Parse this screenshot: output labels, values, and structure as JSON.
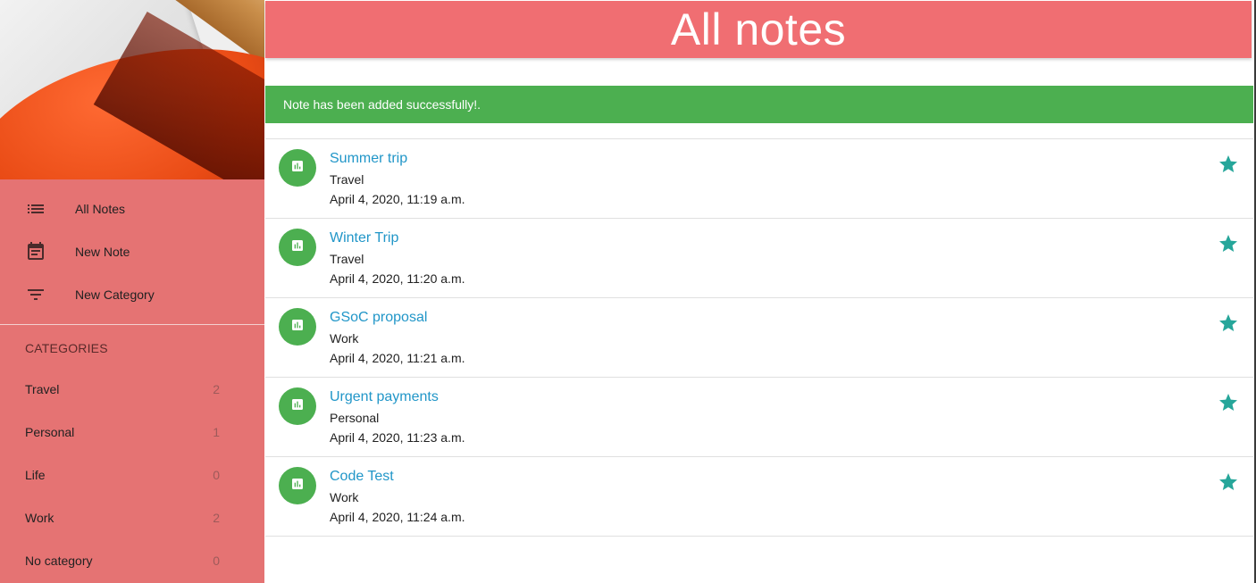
{
  "page": {
    "title": "All notes"
  },
  "sidebar": {
    "nav": [
      {
        "label": "All Notes",
        "icon": "list-icon"
      },
      {
        "label": "New Note",
        "icon": "calendar-note-icon"
      },
      {
        "label": "New Category",
        "icon": "filter-icon"
      }
    ],
    "categories_header": "CATEGORIES",
    "categories": [
      {
        "name": "Travel",
        "count": "2"
      },
      {
        "name": "Personal",
        "count": "1"
      },
      {
        "name": "Life",
        "count": "0"
      },
      {
        "name": "Work",
        "count": "2"
      },
      {
        "name": "No category",
        "count": "0"
      }
    ]
  },
  "alert": {
    "message": "Note has been added successfully!."
  },
  "notes": [
    {
      "title": "Summer trip",
      "category": "Travel",
      "date": "April 4, 2020, 11:19 a.m."
    },
    {
      "title": "Winter Trip",
      "category": "Travel",
      "date": "April 4, 2020, 11:20 a.m."
    },
    {
      "title": "GSoC proposal",
      "category": "Work",
      "date": "April 4, 2020, 11:21 a.m."
    },
    {
      "title": "Urgent payments",
      "category": "Personal",
      "date": "April 4, 2020, 11:23 a.m."
    },
    {
      "title": "Code Test",
      "category": "Work",
      "date": "April 4, 2020, 11:24 a.m."
    }
  ],
  "colors": {
    "sidebar": "#e57373",
    "title_bar": "#f06e72",
    "success": "#4caf50",
    "link": "#2196c8",
    "star": "#26a69a"
  }
}
